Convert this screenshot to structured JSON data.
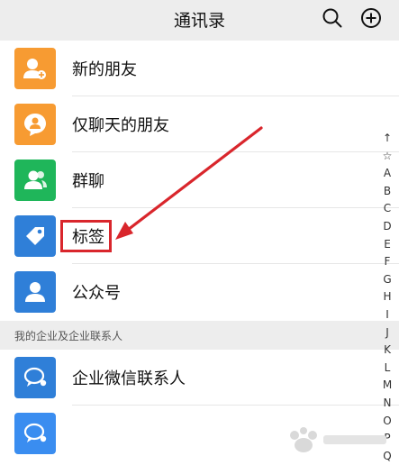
{
  "header": {
    "title": "通讯录"
  },
  "list": [
    {
      "label": "新的朋友",
      "color": "#f79b32",
      "icon": "add-friend-icon"
    },
    {
      "label": "仅聊天的朋友",
      "color": "#f79b32",
      "icon": "chat-only-friend-icon"
    },
    {
      "label": "群聊",
      "color": "#1fb65a",
      "icon": "group-chat-icon"
    },
    {
      "label": "标签",
      "color": "#2f7fd8",
      "icon": "tag-icon"
    },
    {
      "label": "公众号",
      "color": "#2f7fd8",
      "icon": "official-account-icon"
    }
  ],
  "section": {
    "label": "我的企业及企业联系人"
  },
  "enterprise": [
    {
      "label": "企业微信联系人",
      "color": "#2f7fd8",
      "icon": "enterprise-contact-icon"
    },
    {
      "label": "",
      "color": "#3a8df0",
      "icon": "enterprise-contact-icon"
    }
  ],
  "index": [
    "↑",
    "☆",
    "A",
    "B",
    "C",
    "D",
    "E",
    "F",
    "G",
    "H",
    "I",
    "J",
    "K",
    "L",
    "M",
    "N",
    "O",
    "P",
    "Q"
  ],
  "colors": {
    "accent_red": "#d9262c",
    "header_bg": "#ededed"
  }
}
